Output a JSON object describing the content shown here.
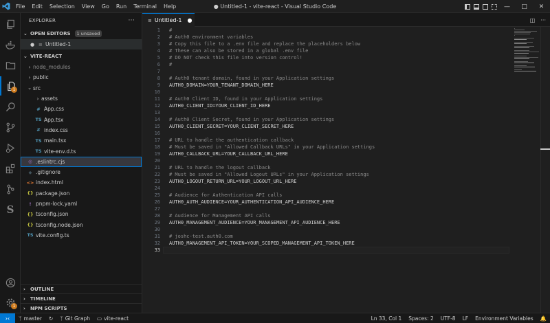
{
  "window_title": "● Untitled-1 - vite-react - Visual Studio Code",
  "menu": [
    "File",
    "Edit",
    "Selection",
    "View",
    "Go",
    "Run",
    "Terminal",
    "Help"
  ],
  "sidebar": {
    "title": "EXPLORER",
    "more": "···",
    "open_editors": {
      "label": "OPEN EDITORS",
      "badge": "1 unsaved",
      "items": [
        {
          "name": "Untitled-1"
        }
      ]
    },
    "project": {
      "label": "VITE-REACT"
    },
    "tree": [
      {
        "name": "node_modules",
        "type": "folder",
        "level": 1,
        "state": "collapsed",
        "ignored": true
      },
      {
        "name": "public",
        "type": "folder",
        "level": 1,
        "state": "collapsed"
      },
      {
        "name": "src",
        "type": "folder",
        "level": 1,
        "state": "expanded"
      },
      {
        "name": "assets",
        "type": "folder",
        "level": 2,
        "state": "collapsed"
      },
      {
        "name": "App.css",
        "type": "css",
        "level": 2
      },
      {
        "name": "App.tsx",
        "type": "ts",
        "level": 2
      },
      {
        "name": "index.css",
        "type": "css",
        "level": 2
      },
      {
        "name": "main.tsx",
        "type": "ts",
        "level": 2
      },
      {
        "name": "vite-env.d.ts",
        "type": "ts",
        "level": 2
      },
      {
        "name": ".eslintrc.cjs",
        "type": "eslint",
        "level": 1,
        "selected": true
      },
      {
        "name": ".gitignore",
        "type": "git",
        "level": 1
      },
      {
        "name": "index.html",
        "type": "html",
        "level": 1
      },
      {
        "name": "package.json",
        "type": "json",
        "level": 1
      },
      {
        "name": "pnpm-lock.yaml",
        "type": "yaml",
        "level": 1
      },
      {
        "name": "tsconfig.json",
        "type": "json",
        "level": 1
      },
      {
        "name": "tsconfig.node.json",
        "type": "json",
        "level": 1
      },
      {
        "name": "vite.config.ts",
        "type": "ts",
        "level": 1
      }
    ],
    "bottom_sections": [
      "OUTLINE",
      "TIMELINE",
      "NPM SCRIPTS"
    ]
  },
  "tab": {
    "label": "Untitled-1"
  },
  "editor": {
    "current_line": 33,
    "lines": [
      {
        "text": "#",
        "kind": "comment"
      },
      {
        "text": "# Auth0 environment variables",
        "kind": "comment"
      },
      {
        "text": "# Copy this file to a .env file and replace the placeholders below",
        "kind": "comment"
      },
      {
        "text": "# These can also be stored in a global .env file",
        "kind": "comment"
      },
      {
        "text": "# DO NOT check this file into version control!",
        "kind": "comment"
      },
      {
        "text": "#",
        "kind": "comment"
      },
      {
        "text": "",
        "kind": "kv"
      },
      {
        "text": "# Auth0 tenant domain, found in your Application settings",
        "kind": "comment"
      },
      {
        "text": "AUTH0_DOMAIN=YOUR_TENANT_DOMAIN_HERE",
        "kind": "kv"
      },
      {
        "text": "",
        "kind": "kv"
      },
      {
        "text": "# Auth0 Client ID, found in your Application settings",
        "kind": "comment"
      },
      {
        "text": "AUTH0_CLIENT_ID=YOUR_CLIENT_ID_HERE",
        "kind": "kv"
      },
      {
        "text": "",
        "kind": "kv"
      },
      {
        "text": "# Auth0 Client Secret, found in your Application settings",
        "kind": "comment"
      },
      {
        "text": "AUTH0_CLIENT_SECRET=YOUR_CLIENT_SECRET_HERE",
        "kind": "kv"
      },
      {
        "text": "",
        "kind": "kv"
      },
      {
        "text": "# URL to handle the authentication callback",
        "kind": "comment"
      },
      {
        "text": "# Must be saved in \"Allowed Callback URLs\" in your Application settings",
        "kind": "comment"
      },
      {
        "text": "AUTH0_CALLBACK_URL=YOUR_CALLBACK_URL_HERE",
        "kind": "kv"
      },
      {
        "text": "",
        "kind": "kv"
      },
      {
        "text": "# URL to handle the logout callback",
        "kind": "comment"
      },
      {
        "text": "# Must be saved in \"Allowed Logout URLs\" in your Application settings",
        "kind": "comment"
      },
      {
        "text": "AUTH0_LOGOUT_RETURN_URL=YOUR_LOGOUT_URL_HERE",
        "kind": "kv"
      },
      {
        "text": "",
        "kind": "kv"
      },
      {
        "text": "# Audience for Authentication API calls",
        "kind": "comment"
      },
      {
        "text": "AUTH0_AUTH_AUDIENCE=YOUR_AUTHENTICATION_API_AUDIENCE_HERE",
        "kind": "kv"
      },
      {
        "text": "",
        "kind": "kv"
      },
      {
        "text": "# Audience for Management API calls",
        "kind": "comment"
      },
      {
        "text": "AUTH0_MANAGEMENT_AUDIENCE=YOUR_MANAGEMENT_API_AUDIENCE_HERE",
        "kind": "kv"
      },
      {
        "text": "",
        "kind": "kv"
      },
      {
        "text": "# joshc-test.auth0.com",
        "kind": "comment"
      },
      {
        "text": "AUTH0_MANAGEMENT_API_TOKEN=YOUR_SCOPED_MANAGEMENT_API_TOKEN_HERE",
        "kind": "kv"
      },
      {
        "text": "",
        "kind": "kv"
      }
    ]
  },
  "statusbar": {
    "branch": "master",
    "git_graph": "Git Graph",
    "folder": "vite-react",
    "position": "Ln 33, Col 1",
    "spaces": "Spaces: 2",
    "encoding": "UTF-8",
    "eol": "LF",
    "language": "Environment Variables"
  },
  "activity_badges": {
    "explorer": "1",
    "settings": "1"
  },
  "colors": {
    "accent": "#0078d4",
    "badge": "#ce7b1e",
    "background": "#1f1f1f"
  }
}
